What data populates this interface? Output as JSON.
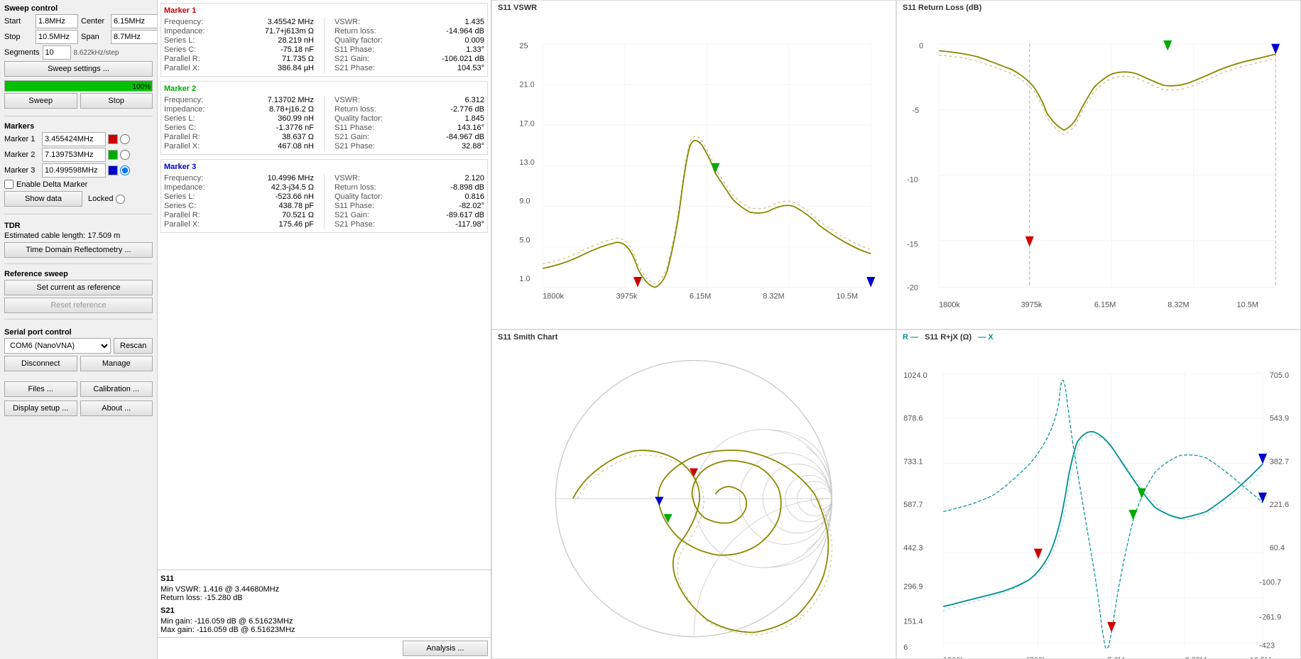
{
  "sweep_control": {
    "title": "Sweep control",
    "start_label": "Start",
    "start_value": "1.8MHz",
    "center_label": "Center",
    "center_value": "6.15MHz",
    "stop_label": "Stop",
    "stop_value": "10.5MHz",
    "span_label": "Span",
    "span_value": "8.7MHz",
    "segments_label": "Segments",
    "segments_value": "10",
    "step_value": "8.622kHz/step",
    "sweep_settings_btn": "Sweep settings ...",
    "progress_pct": "100%",
    "sweep_btn": "Sweep",
    "stop_btn": "Stop"
  },
  "markers": {
    "title": "Markers",
    "m1_label": "Marker 1",
    "m1_value": "3.455424MHz",
    "m1_color": "#cc0000",
    "m2_label": "Marker 2",
    "m2_value": "7.139753MHz",
    "m2_color": "#00aa00",
    "m3_label": "Marker 3",
    "m3_value": "10.499598MHz",
    "m3_color": "#0000cc",
    "enable_delta": "Enable Delta Marker",
    "show_data_btn": "Show data",
    "locked_label": "Locked"
  },
  "tdr": {
    "title": "TDR",
    "cable_length_label": "Estimated cable length:",
    "cable_length_value": "17.509 m",
    "tdr_btn": "Time Domain Reflectometry ..."
  },
  "reference_sweep": {
    "title": "Reference sweep",
    "set_reference_btn": "Set current as reference",
    "reset_reference_btn": "Reset reference"
  },
  "serial_port": {
    "title": "Serial port control",
    "port_value": "COM6 (NanoVNA)",
    "rescan_btn": "Rescan",
    "disconnect_btn": "Disconnect",
    "manage_btn": "Manage"
  },
  "bottom_btns": {
    "files_btn": "Files ...",
    "calibration_btn": "Calibration ...",
    "display_setup_btn": "Display setup ...",
    "about_btn": "About ..."
  },
  "marker1_data": {
    "title": "Marker 1",
    "frequency": "3.45542 MHz",
    "impedance": "71.7+j613m Ω",
    "series_l": "28.219 nH",
    "series_c": "-75.18 nF",
    "parallel_r": "71.735 Ω",
    "parallel_x": "386.84 µH",
    "vswr": "1.435",
    "return_loss": "-14.964 dB",
    "quality_factor": "0.009",
    "s11_phase": "1.33°",
    "s21_gain": "-106.021 dB",
    "s21_phase": "104.53°"
  },
  "marker2_data": {
    "title": "Marker 2",
    "frequency": "7.13702 MHz",
    "impedance": "8.78+j16.2 Ω",
    "series_l": "360.99 nH",
    "series_c": "-1.3776 nF",
    "parallel_r": "38.637 Ω",
    "parallel_x": "467.08 nH",
    "vswr": "6.312",
    "return_loss": "-2.776 dB",
    "quality_factor": "1.845",
    "s11_phase": "143.16°",
    "s21_gain": "-84.967 dB",
    "s21_phase": "32.88°"
  },
  "marker3_data": {
    "title": "Marker 3",
    "frequency": "10.4996 MHz",
    "impedance": "42.3-j34.5 Ω",
    "series_l": "-523.66 nH",
    "series_c": "438.78 pF",
    "parallel_r": "70.521 Ω",
    "parallel_x": "175.46 pF",
    "vswr": "2.120",
    "return_loss": "-8.898 dB",
    "quality_factor": "0.816",
    "s11_phase": "-82.02°",
    "s21_gain": "-89.617 dB",
    "s21_phase": "-117.98°"
  },
  "s11_summary": {
    "title": "S11",
    "min_vswr_label": "Min VSWR:",
    "min_vswr_value": "1.416 @ 3.44680MHz",
    "return_loss_label": "Return loss:",
    "return_loss_value": "-15.280 dB",
    "s21_title": "S21",
    "min_gain_label": "Min gain:",
    "min_gain_value": "-116.059 dB @ 6.51623MHz",
    "max_gain_label": "Max gain:",
    "max_gain_value": "-116.059 dB @ 6.51623MHz"
  },
  "analysis_btn": "Analysis ...",
  "charts": {
    "vswr_title": "S11 VSWR",
    "return_loss_title": "S11 Return Loss (dB)",
    "smith_title": "S11 Smith Chart",
    "rxj_title": "S11 R+jX (Ω)",
    "rxj_r_label": "R —",
    "rxj_x_label": "— X"
  }
}
